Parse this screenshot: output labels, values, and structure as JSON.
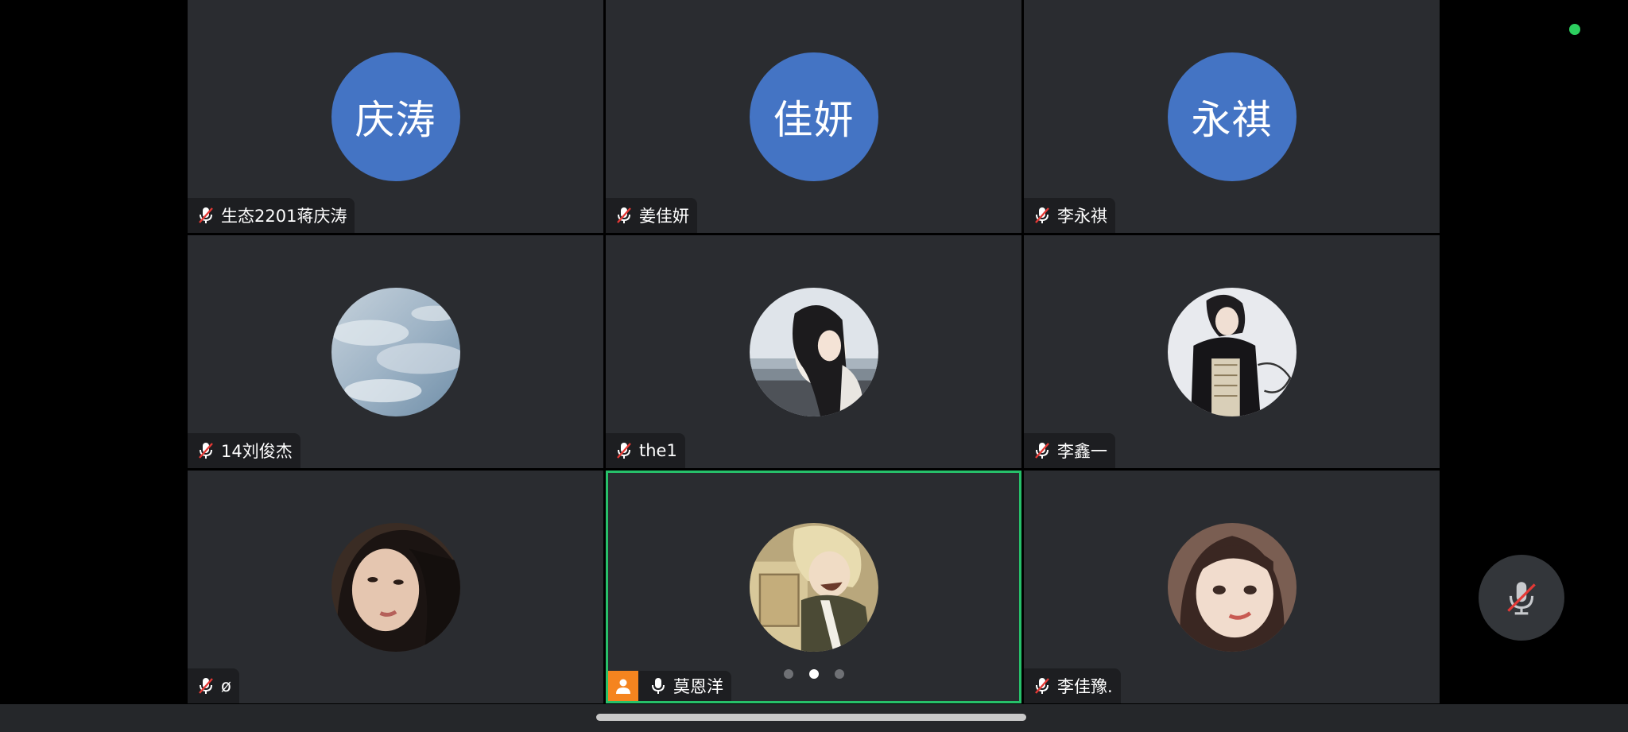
{
  "participants": [
    {
      "initials": "庆涛",
      "name": "生态2201蒋庆涛",
      "muted": true
    },
    {
      "initials": "佳妍",
      "name": "姜佳妍",
      "muted": true
    },
    {
      "initials": "永祺",
      "name": "李永祺",
      "muted": true
    },
    {
      "photo": "sky-clouds",
      "name": "14刘俊杰",
      "muted": true
    },
    {
      "photo": "girl-seaside",
      "name": "the1",
      "muted": true
    },
    {
      "photo": "girl-dark-dress",
      "name": "李鑫一",
      "muted": true
    },
    {
      "photo": "girl-portrait",
      "name": "ø",
      "muted": true
    },
    {
      "photo": "anime-boy",
      "name": "莫恩洋",
      "muted": false,
      "is_self": true,
      "speaking": true
    },
    {
      "photo": "anime-girl",
      "name": "李佳豫.",
      "muted": true
    }
  ],
  "pager": {
    "pages": 3,
    "current": 2
  },
  "controls": {
    "mic_muted": true
  },
  "colors": {
    "accent_green": "#27c06a",
    "avatar_blue": "#4474c4",
    "self_badge_orange": "#f5841f",
    "tile_bg": "#2a2c30"
  }
}
